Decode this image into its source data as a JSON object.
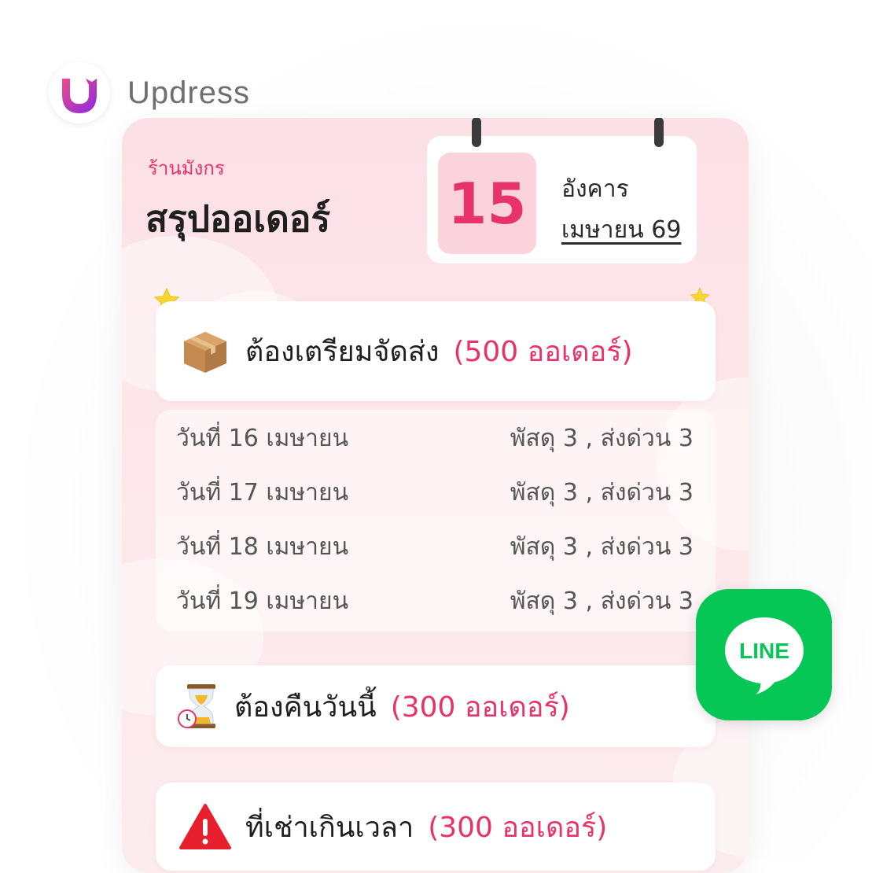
{
  "brand": {
    "name": "Updress"
  },
  "header": {
    "shop_name": "ร้านมังกร",
    "title": "สรุปออเดอร์"
  },
  "calendar": {
    "day": "15",
    "weekday": "อังคาร",
    "month_year": "เมษายน 69"
  },
  "sections": {
    "prepare": {
      "label": "ต้องเตรียมจัดส่ง",
      "count": "(500 ออเดอร์)",
      "icon": "package-icon"
    },
    "return_today": {
      "label": "ต้องคืนวันนี้",
      "count": "(300 ออเดอร์)",
      "icon": "hourglass-icon"
    },
    "overdue": {
      "label": "ที่เช่าเกินเวลา",
      "count": "(300 ออเดอร์)",
      "icon": "warning-icon"
    }
  },
  "schedule": [
    {
      "date": "วันที่ 16 เมษายน",
      "detail": "พัสดุ 3 , ส่งด่วน 3"
    },
    {
      "date": "วันที่ 17 เมษายน",
      "detail": "พัสดุ 3 , ส่งด่วน 3"
    },
    {
      "date": "วันที่ 18 เมษายน",
      "detail": "พัสดุ 3 , ส่งด่วน 3"
    },
    {
      "date": "วันที่ 19 เมษายน",
      "detail": "พัสดุ 3 , ส่งด่วน 3"
    }
  ],
  "line_badge": {
    "text": "LINE",
    "color": "#06c755"
  },
  "colors": {
    "accent": "#e8336a",
    "card_bg": "#fbe0e6"
  }
}
